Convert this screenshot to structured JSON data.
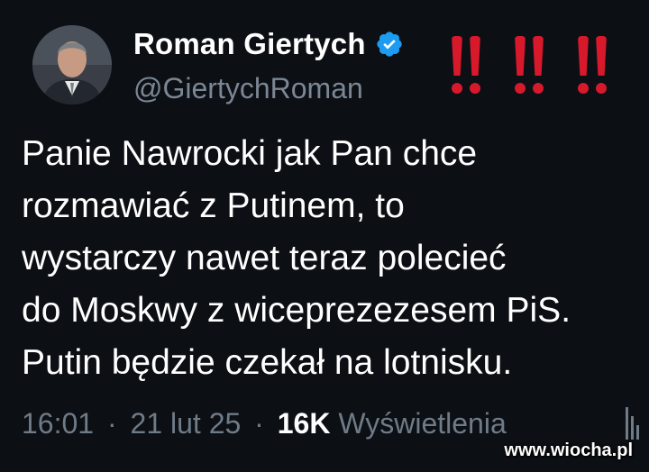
{
  "colors": {
    "background": "#0c0f14",
    "text": "#ffffff",
    "muted": "#6f7b87",
    "verified_badge": "#1d9bf0",
    "exclamation": "#d7192b"
  },
  "author": {
    "display_name": "Roman Giertych",
    "handle": "@GiertychRoman",
    "verified_icon": "verified-badge-icon",
    "avatar": "avatar-photo"
  },
  "decoration": {
    "exclamation_icon": "double-exclamation-icon",
    "exclamation_count": 3
  },
  "tweet": {
    "text": "Panie Nawrocki jak Pan chce\nrozmawiać z Putinem, to\nwystarczy nawet teraz polecieć\ndo Moskwy z wiceprezezesem PiS.\nPutin będzie czekał na lotnisku."
  },
  "meta": {
    "time": "16:01",
    "date": "21 lut 25",
    "separator": "·",
    "views_count": "16K",
    "views_label": "Wyświetlenia",
    "analytics_icon": "analytics-icon"
  },
  "watermark": "www.wiocha.pl"
}
